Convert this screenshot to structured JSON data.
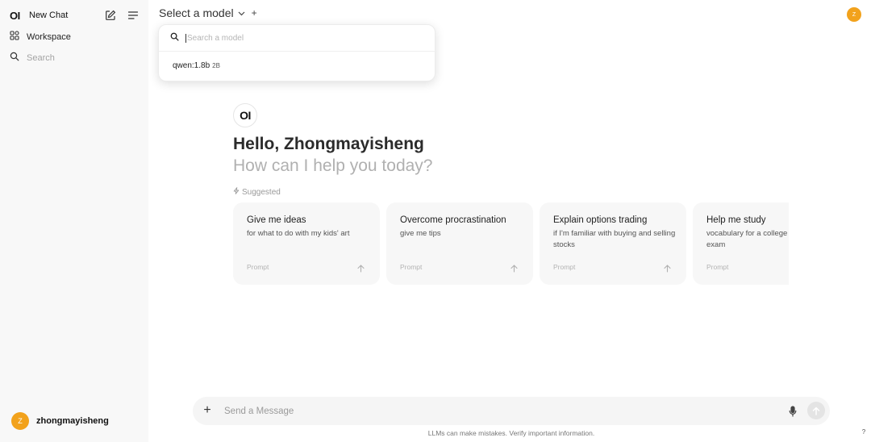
{
  "sidebar": {
    "logo": "OI",
    "new_chat": "New Chat",
    "workspace": "Workspace",
    "search": "Search",
    "user": {
      "initial": "Z",
      "name": "zhongmayisheng"
    }
  },
  "header": {
    "model_select_label": "Select a model",
    "add_symbol": "+",
    "avatar_initial": "Z"
  },
  "dropdown": {
    "search_placeholder": "Search a model",
    "items": [
      {
        "name": "qwen:1.8b",
        "size": "2B"
      }
    ]
  },
  "hero": {
    "logo": "OI",
    "greeting": "Hello, Zhongmayisheng",
    "subtitle": "How can I help you today?",
    "suggested_label": "Suggested"
  },
  "suggestions": [
    {
      "title": "Give me ideas",
      "subtitle": "for what to do with my kids' art",
      "tag": "Prompt"
    },
    {
      "title": "Overcome procrastination",
      "subtitle": "give me tips",
      "tag": "Prompt"
    },
    {
      "title": "Explain options trading",
      "subtitle": "if I'm familiar with buying and selling stocks",
      "tag": "Prompt"
    },
    {
      "title": "Help me study",
      "subtitle": "vocabulary for a college entrance exam",
      "tag": "Prompt"
    }
  ],
  "composer": {
    "add_symbol": "+",
    "placeholder": "Send a Message"
  },
  "footer": {
    "disclaimer": "LLMs can make mistakes. Verify important information.",
    "help": "?"
  },
  "colors": {
    "sidebar_bg": "#f8f8f8",
    "avatar": "#f2a21c",
    "card_bg": "#f7f7f7",
    "composer_bg": "#f5f5f5"
  }
}
